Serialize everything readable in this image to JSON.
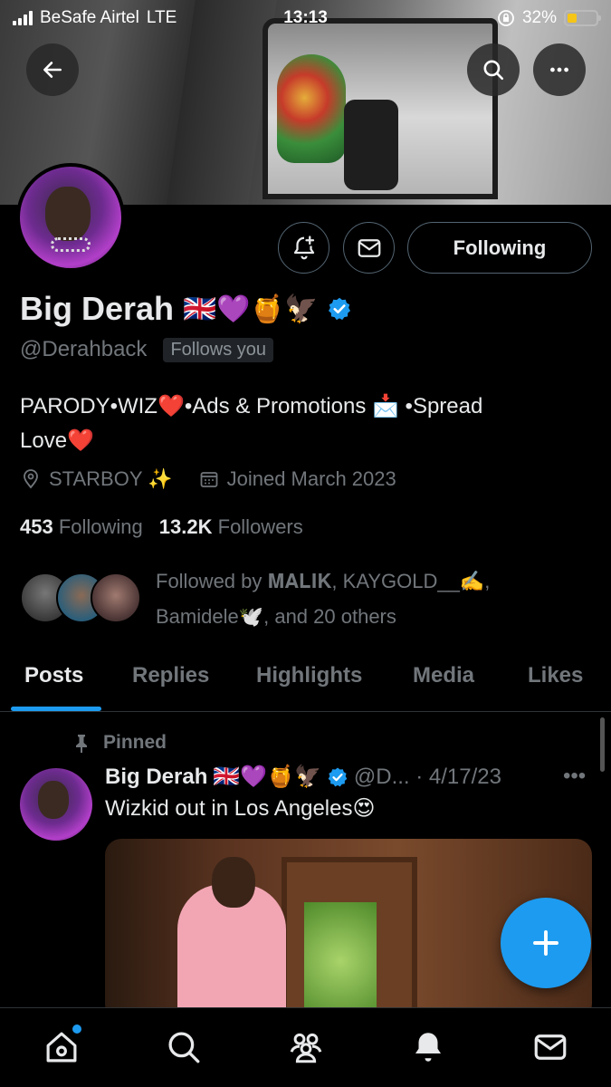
{
  "status_bar": {
    "carrier": "BeSafe Airtel",
    "network": "LTE",
    "time": "13:13",
    "battery_percent": "32%",
    "battery_level": 0.32
  },
  "header": {
    "back_icon": "arrow-left-icon",
    "search_icon": "search-icon",
    "more_icon": "more-horizontal-icon"
  },
  "profile": {
    "display_name": "Big Derah",
    "name_emojis": "🇬🇧💜🍯🦅",
    "handle": "@Derahback",
    "follows_you": "Follows you",
    "bio_line1": "PARODY•WIZ❤️•Ads & Promotions 📩 •Spread",
    "bio_line2": "Love❤️",
    "location": "STARBOY ✨",
    "joined": "Joined March 2023",
    "following_count": "453",
    "following_label": "Following",
    "followers_count": "13.2K",
    "followers_label": "Followers",
    "followed_by_line1": "Followed by 𝐌𝐀𝐋𝐈𝐊, KAYGOLD__✍️,",
    "followed_by_line2": "Bamidele🕊️, and 20 others",
    "accent_color": "#1d9bf0"
  },
  "actions": {
    "following_button": "Following"
  },
  "tabs": [
    "Posts",
    "Replies",
    "Highlights",
    "Media",
    "Likes"
  ],
  "active_tab": "Posts",
  "pinned_post": {
    "pinned_label": "Pinned",
    "author": "Big Derah",
    "author_emojis": "🇬🇧💜🍯🦅",
    "handle_date": "@D... · 4/17/23",
    "more": "•••",
    "text": "Wizkid out in Los Angeles😍"
  },
  "bottom_nav": [
    "home-icon",
    "search-icon",
    "communities-icon",
    "notifications-icon",
    "messages-icon"
  ]
}
